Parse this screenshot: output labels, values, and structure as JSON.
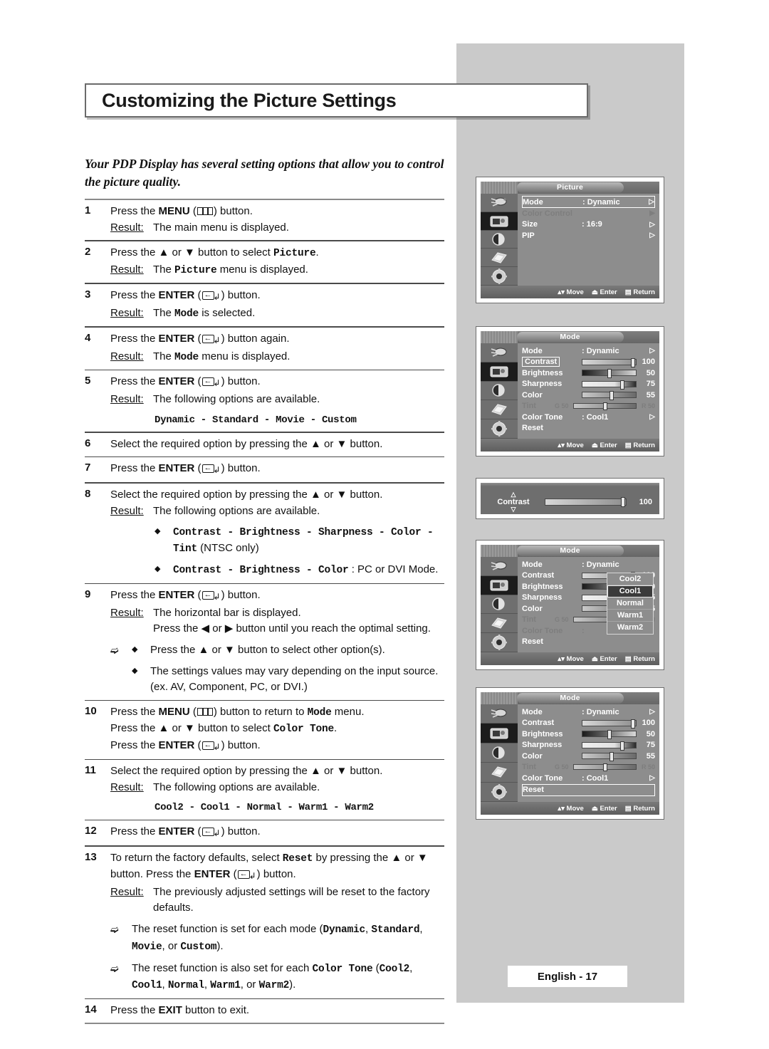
{
  "page": {
    "title": "Customizing the Picture Settings",
    "intro": "Your PDP Display has several setting options that allow you to control the picture quality.",
    "footer": "English - 17"
  },
  "labels": {
    "result": "Result:",
    "press_the": "Press the",
    "button": "button."
  },
  "steps": [
    {
      "num": "1",
      "line1_a": "Press the ",
      "line1_b": "MENU",
      "line1_c": " (",
      "line1_d": ") button.",
      "result": "The main menu is displayed."
    },
    {
      "num": "2",
      "text_a": "Press the ▲ or ▼ button to select ",
      "text_b": "Picture",
      "text_c": ".",
      "res_a": "The ",
      "res_b": "Picture",
      "res_c": " menu is displayed."
    },
    {
      "num": "3",
      "text_a": "Press the ",
      "text_b": "ENTER",
      "text_c": " (",
      "text_d": ") button.",
      "res_a": "The ",
      "res_b": "Mode",
      "res_c": " is selected."
    },
    {
      "num": "4",
      "text_d": ") button again.",
      "res_a": "The ",
      "res_b": "Mode",
      "res_c": " menu is displayed."
    },
    {
      "num": "5",
      "text_d": ") button.",
      "res": "The following options are available.",
      "options": "Dynamic - Standard - Movie - Custom"
    },
    {
      "num": "6",
      "text": "Select the required option by pressing the ▲ or ▼ button."
    },
    {
      "num": "7",
      "text_d": ") button."
    },
    {
      "num": "8",
      "text": "Select the required option by pressing the ▲ or ▼ button.",
      "res": "The following options are available.",
      "bullet1_mono_a": "Contrast - Brightness - Sharpness - Color -",
      "bullet1_mono_b": "Tint",
      "bullet1_plain": " (NTSC only)",
      "bullet2_mono": "Contrast - Brightness  - Color",
      "bullet2_plain": " : PC or DVI Mode."
    },
    {
      "num": "9",
      "text_d": ") button.",
      "res_line1": "The horizontal bar is displayed.",
      "res_line2": "Press the ◀ or ▶ button until you reach the optimal setting.",
      "note1": "Press the ▲ or ▼ button to select other option(s).",
      "note2": "The settings values may vary depending on the input source. (ex. AV, Component, PC, or DVI.)"
    },
    {
      "num": "10",
      "l1_a": "Press the ",
      "l1_b": "MENU",
      "l1_c": " (",
      "l1_d": ") button to return to ",
      "l1_e": "Mode",
      "l1_f": " menu.",
      "l2_a": "Press the ▲ or ▼ button to select ",
      "l2_b": "Color Tone",
      "l2_c": ".",
      "l3_d": ") button."
    },
    {
      "num": "11",
      "text": "Select the required option by pressing the ▲ or ▼ button.",
      "res": "The following options are available.",
      "options": "Cool2 - Cool1 - Normal - Warm1 - Warm2"
    },
    {
      "num": "12",
      "text_d": ") button."
    },
    {
      "num": "13",
      "l1_a": "To return the factory defaults, select ",
      "l1_b": "Reset",
      "l1_c": " by pressing the ▲ or ▼ button. Press the ",
      "l1_d": "ENTER",
      "l1_e": " (",
      "l1_f": ") button.",
      "res": "The previously adjusted settings will be reset to the factory defaults.",
      "note1_a": "The reset function is set for each mode (",
      "note1_b": "Dynamic",
      "note1_c": ", ",
      "note1_d": "Standard",
      "note1_e": ", ",
      "note1_f": "Movie",
      "note1_g": ", or ",
      "note1_h": "Custom",
      "note1_i": ").",
      "note2_a": "The reset function is also set for each ",
      "note2_b": "Color Tone",
      "note2_c": " (",
      "note2_d": "Cool2",
      "note2_e": ", ",
      "note2_f": "Cool1",
      "note2_g": ", ",
      "note2_h": "Normal",
      "note2_i": ", ",
      "note2_j": "Warm1",
      "note2_k": ", or ",
      "note2_l": "Warm2",
      "note2_m": ")."
    },
    {
      "num": "14",
      "text_a": "Press the ",
      "text_b": "EXIT",
      "text_c": " button to exit."
    }
  ],
  "osd_common": {
    "footer": {
      "move": "Move",
      "enter": "Enter",
      "return": "Return"
    },
    "side_icons": [
      "input-source-icon",
      "picture-icon",
      "sound-icon",
      "channel-icon",
      "setup-icon"
    ]
  },
  "osd_picture": {
    "title": "Picture",
    "rows": [
      {
        "label": "Mode",
        "value": ": Dynamic",
        "arrow": "▷",
        "selected": true,
        "dim": false
      },
      {
        "label": "Color Control",
        "value": "",
        "arrow": "▶",
        "selected": false,
        "dim": true
      },
      {
        "label": "Size",
        "value": ": 16:9",
        "arrow": "▷",
        "selected": false,
        "dim": false
      },
      {
        "label": "PIP",
        "value": "",
        "arrow": "▷",
        "selected": false,
        "dim": false
      }
    ]
  },
  "osd_mode1": {
    "title": "Mode",
    "mode_label": "Mode",
    "mode_value": ": Dynamic",
    "mode_arrow": "▷",
    "sliders": [
      {
        "label": "Contrast",
        "value": "100",
        "pct": 100,
        "boxed": true,
        "dim": false
      },
      {
        "label": "Brightness",
        "value": "50",
        "pct": 50,
        "boxed": false,
        "dim": false
      },
      {
        "label": "Sharpness",
        "value": "75",
        "pct": 75,
        "boxed": false,
        "dim": false
      },
      {
        "label": "Color",
        "value": "55",
        "pct": 55,
        "boxed": false,
        "dim": false
      }
    ],
    "tint": {
      "label": "Tint",
      "left": "G 50",
      "right": "R 50",
      "pct": 50
    },
    "color_tone": {
      "label": "Color Tone",
      "value": ": Cool1",
      "arrow": "▷"
    },
    "reset": "Reset"
  },
  "osd_contrast": {
    "label": "Contrast",
    "value": "100",
    "pct": 100,
    "up": "△",
    "down": "▽"
  },
  "osd_mode_dropdown": {
    "title": "Mode",
    "mode_label": "Mode",
    "mode_value": ": Dynamic",
    "sliders": [
      {
        "label": "Contrast",
        "value": "100",
        "pct": 100,
        "dim": false
      },
      {
        "label": "Brightness",
        "value": "50",
        "pct": 50,
        "dim": false
      },
      {
        "label": "Sharpness",
        "value": "75",
        "pct": 75,
        "dim": false
      },
      {
        "label": "Color",
        "value": "55",
        "pct": 55,
        "dim": false
      }
    ],
    "tint": {
      "label": "Tint",
      "left": "G 50",
      "right": "50",
      "pct": 50
    },
    "color_tone": {
      "label": "Color Tone",
      "value": ":"
    },
    "reset": "Reset",
    "dropdown": [
      {
        "label": "Cool2",
        "selected": false
      },
      {
        "label": "Cool1",
        "selected": true
      },
      {
        "label": "Normal",
        "selected": false
      },
      {
        "label": "Warm1",
        "selected": false
      },
      {
        "label": "Warm2",
        "selected": false
      }
    ]
  },
  "osd_mode_reset": {
    "title": "Mode",
    "mode_label": "Mode",
    "mode_value": ": Dynamic",
    "mode_arrow": "▷",
    "sliders": [
      {
        "label": "Contrast",
        "value": "100",
        "pct": 100
      },
      {
        "label": "Brightness",
        "value": "50",
        "pct": 50
      },
      {
        "label": "Sharpness",
        "value": "75",
        "pct": 75
      },
      {
        "label": "Color",
        "value": "55",
        "pct": 55
      }
    ],
    "tint": {
      "label": "Tint",
      "left": "G 50",
      "right": "R 50",
      "pct": 50
    },
    "color_tone": {
      "label": "Color Tone",
      "value": ": Cool1",
      "arrow": "▷"
    },
    "reset": "Reset"
  }
}
